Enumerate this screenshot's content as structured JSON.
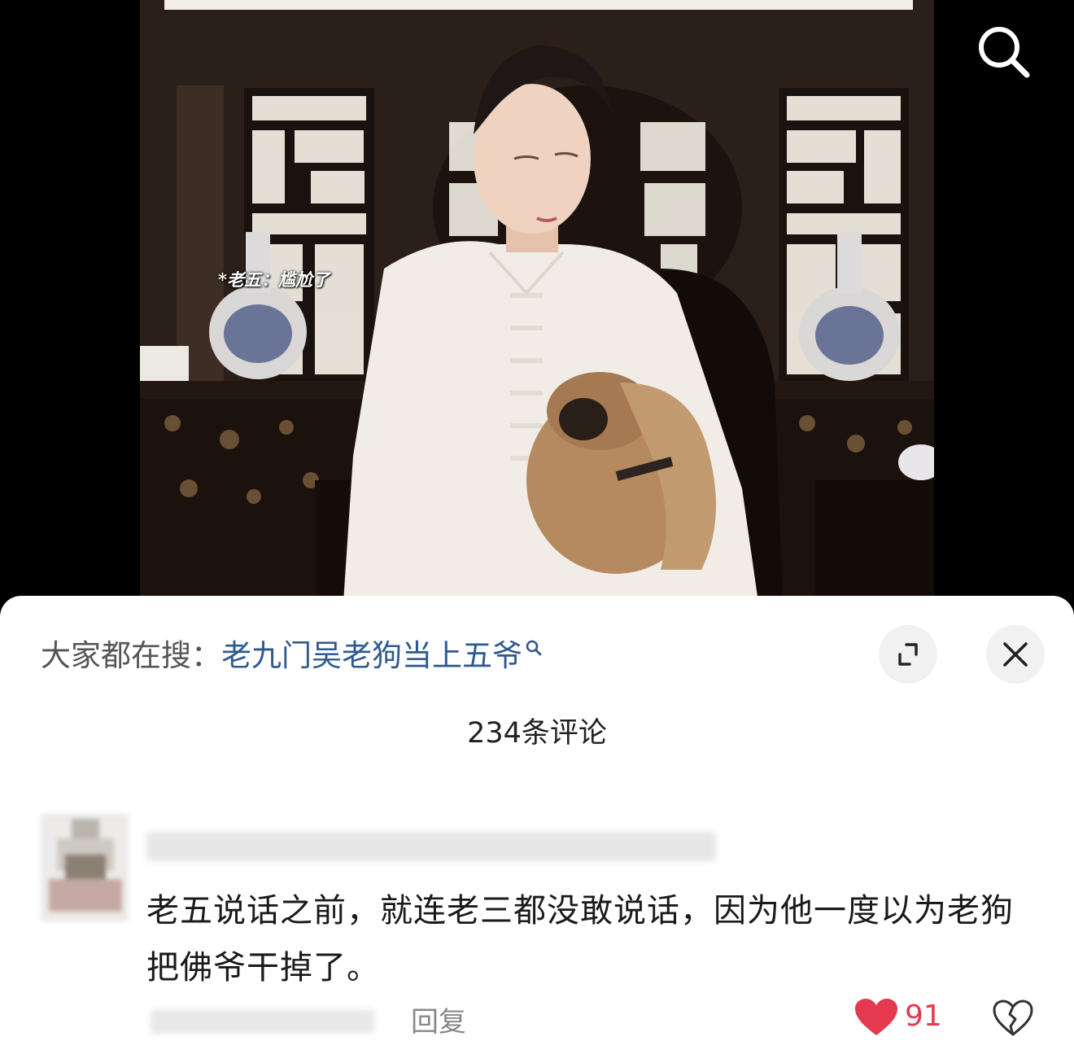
{
  "video": {
    "overlay_caption": "*老五：尴尬了"
  },
  "top_search": {
    "icon": "search-icon"
  },
  "sheet": {
    "search_suggest": {
      "prefix": "大家都在搜：",
      "term": "老九门吴老狗当上五爷"
    },
    "expand_icon": "expand-icon",
    "close_icon": "close-icon",
    "comment_count": "234条评论"
  },
  "comment": {
    "text": "老五说话之前，就连老三都没敢说话，因为他一度以为老狗把佛爷干掉了。",
    "reply_label": "回复",
    "like_count": "91",
    "like_color": "#e4394f"
  }
}
